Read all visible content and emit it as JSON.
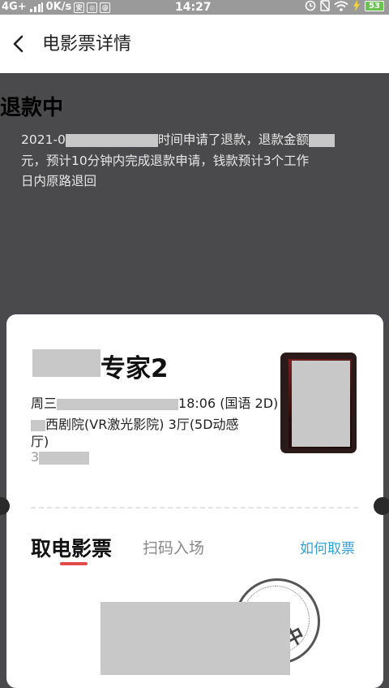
{
  "status_bar": {
    "network": "4G+",
    "speed": "0K/s",
    "time": "14:27",
    "battery": "53"
  },
  "nav": {
    "back_icon": "chevron-left-icon",
    "title": "电影票详情"
  },
  "refund": {
    "status": "退款中",
    "desc_line1_prefix": "2021-0",
    "desc_line1_suffix": "时间申请了退款，退款金额",
    "desc_line2": "元，预计10分钟内完成退款申请，钱款预计3个工作",
    "desc_line3": "日内原路退回"
  },
  "ticket": {
    "title_visible": "专家2",
    "time_prefix": "周三",
    "time_suffix": "18:06 (国语 2D)",
    "cinema": "西剧院(VR激光影院) 3厅(5D动感",
    "cinema_line2": "厅)",
    "seat_prefix": "3"
  },
  "tabs": {
    "active": "取电影票",
    "inactive": "扫码入场",
    "help": "如何取票"
  },
  "stamp": {
    "text": "中"
  }
}
